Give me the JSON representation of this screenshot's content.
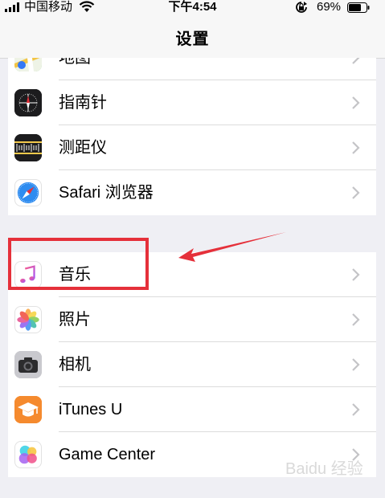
{
  "status_bar": {
    "carrier": "中国移动",
    "time": "下午4:54",
    "battery": "69%"
  },
  "nav": {
    "title": "设置"
  },
  "group1": {
    "partial_label": "地图",
    "rows": [
      {
        "label": "指南针",
        "icon": "compass-icon"
      },
      {
        "label": "测距仪",
        "icon": "ruler-icon"
      },
      {
        "label": "Safari 浏览器",
        "icon": "safari-icon"
      }
    ]
  },
  "group2": {
    "rows": [
      {
        "label": "音乐",
        "icon": "music-icon"
      },
      {
        "label": "照片",
        "icon": "photos-icon"
      },
      {
        "label": "相机",
        "icon": "camera-icon"
      },
      {
        "label": "iTunes U",
        "icon": "itunes-u-icon"
      },
      {
        "label": "Game Center",
        "icon": "game-center-icon"
      }
    ]
  },
  "annotation": {
    "highlight_color": "#e5303a"
  },
  "watermark": "Baidu 经验"
}
